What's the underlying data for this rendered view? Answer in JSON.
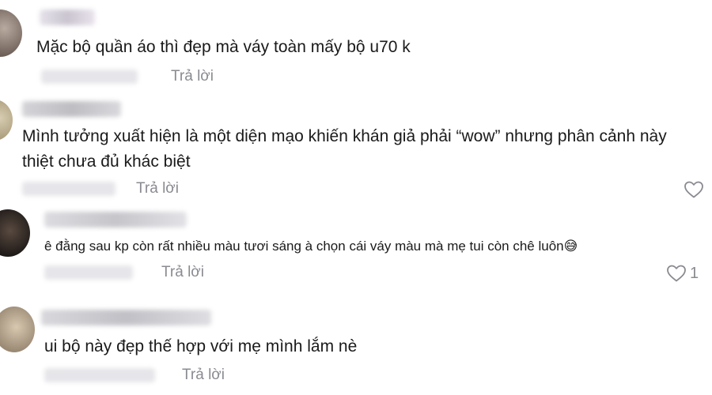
{
  "comments": [
    {
      "text": "Mặc bộ quần áo thì đẹp mà váy toàn mấy bộ u70 k",
      "reply_label": "Trả lời"
    },
    {
      "text_line1": "Mình tưởng xuất hiện là một diện mạo khiến khán giả phải “wow” nhưng phân cảnh này",
      "text_line2": "thiệt chưa đủ khác biệt",
      "reply_label": "Trả lời"
    },
    {
      "text": "ê đằng sau kp còn rất nhiều màu tươi sáng à chọn cái váy màu mà mẹ tui còn chê luôn😅",
      "reply_label": "Trả lời",
      "like_count": "1"
    },
    {
      "text": "ui bộ này đẹp thế hợp với mẹ mình lắm nè",
      "reply_label": "Trả lời"
    }
  ],
  "icons": {
    "like": "heart-outline-icon"
  },
  "colors": {
    "text": "#1a1a1a",
    "muted": "#8a8b91",
    "blur": "#e6e6ea"
  }
}
